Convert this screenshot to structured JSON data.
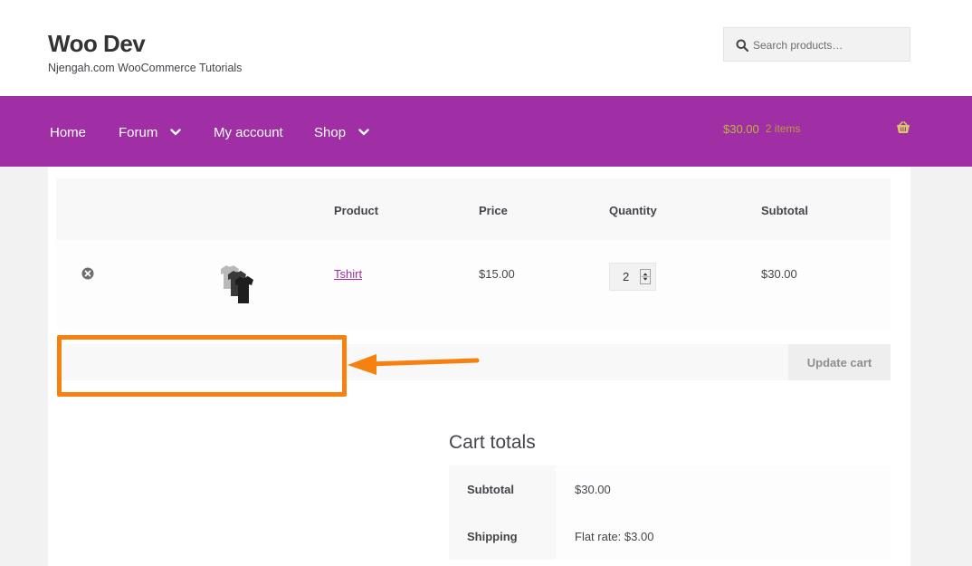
{
  "site": {
    "title": "Woo Dev",
    "tagline": "Njengah.com WooCommerce Tutorials"
  },
  "search": {
    "placeholder": "Search products…",
    "icon": "search-icon"
  },
  "nav": {
    "items": [
      {
        "label": "Home",
        "has_dropdown": false
      },
      {
        "label": "Forum",
        "has_dropdown": true
      },
      {
        "label": "My account",
        "has_dropdown": false
      },
      {
        "label": "Shop",
        "has_dropdown": true
      }
    ],
    "cart": {
      "amount": "$30.00",
      "count": "2 items",
      "icon": "basket-icon"
    }
  },
  "cart_table": {
    "headers": [
      "Product",
      "Price",
      "Quantity",
      "Subtotal"
    ],
    "rows": [
      {
        "product": "Tshirt",
        "price": "$15.00",
        "quantity": "2",
        "subtotal": "$30.00"
      }
    ],
    "update_button": "Update cart"
  },
  "cart_totals": {
    "title": "Cart totals",
    "rows": [
      {
        "label": "Subtotal",
        "value": "$30.00"
      },
      {
        "label": "Shipping",
        "value": "Flat rate: $3.00"
      }
    ]
  },
  "colors": {
    "brand_purple": "#a02ea5",
    "annotation_orange": "#f6810f"
  }
}
